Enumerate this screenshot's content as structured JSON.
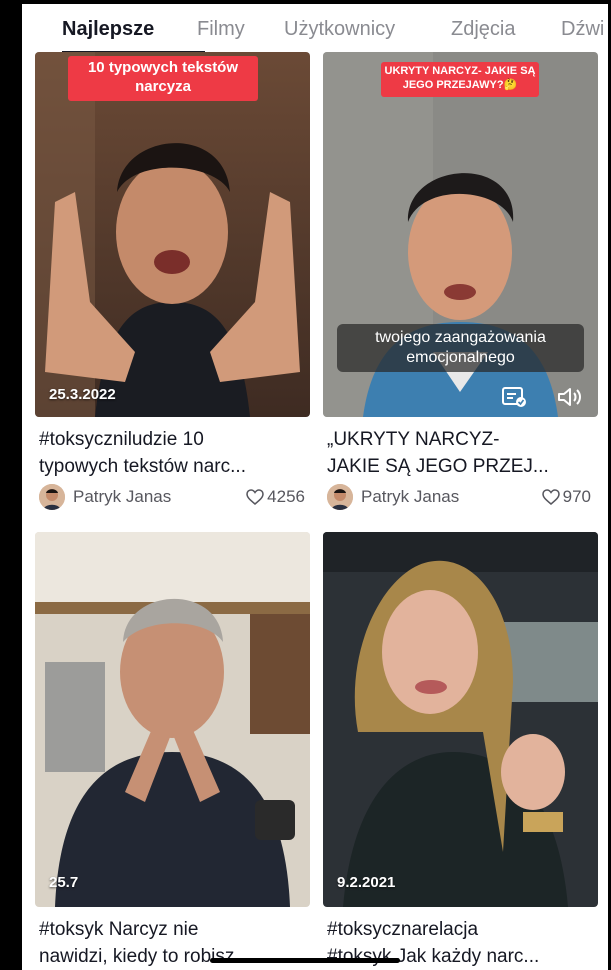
{
  "tabs": [
    {
      "label": "Najlepsze",
      "active": true
    },
    {
      "label": "Filmy",
      "active": false
    },
    {
      "label": "Użytkownicy",
      "active": false
    },
    {
      "label": "Zdjęcia",
      "active": false
    },
    {
      "label": "Dźwi",
      "active": false
    }
  ],
  "videos": [
    {
      "overlay_text": "10 typowych tekstów narcyza",
      "date": "25.3.2022",
      "description_line1": "#toksyczniludzie 10",
      "description_line2": "typowych tekstów narc...",
      "author": "Patryk Janas",
      "likes": "4256"
    },
    {
      "overlay_text": "UKRYTY NARCYZ- JAKIE SĄ JEGO PRZEJAWY?🤔",
      "caption": "twojego zaangażowania emocjonalnego",
      "description_line1": "„UKRYTY NARCYZ-",
      "description_line2": "JAKIE SĄ JEGO PRZEJ...",
      "author": "Patryk Janas",
      "likes": "970"
    },
    {
      "date": "25.7",
      "description_line1": "#toksyk Narcyz nie",
      "description_line2": "nawidzi, kiedy to robisz..."
    },
    {
      "date": "9.2.2021",
      "description_line1": "#toksycznarelacja",
      "description_line2": "#toksyk Jak każdy narc..."
    }
  ],
  "colors": {
    "accent_red": "#ee3a45",
    "text_primary": "#161823",
    "text_secondary": "#8a8b91"
  }
}
